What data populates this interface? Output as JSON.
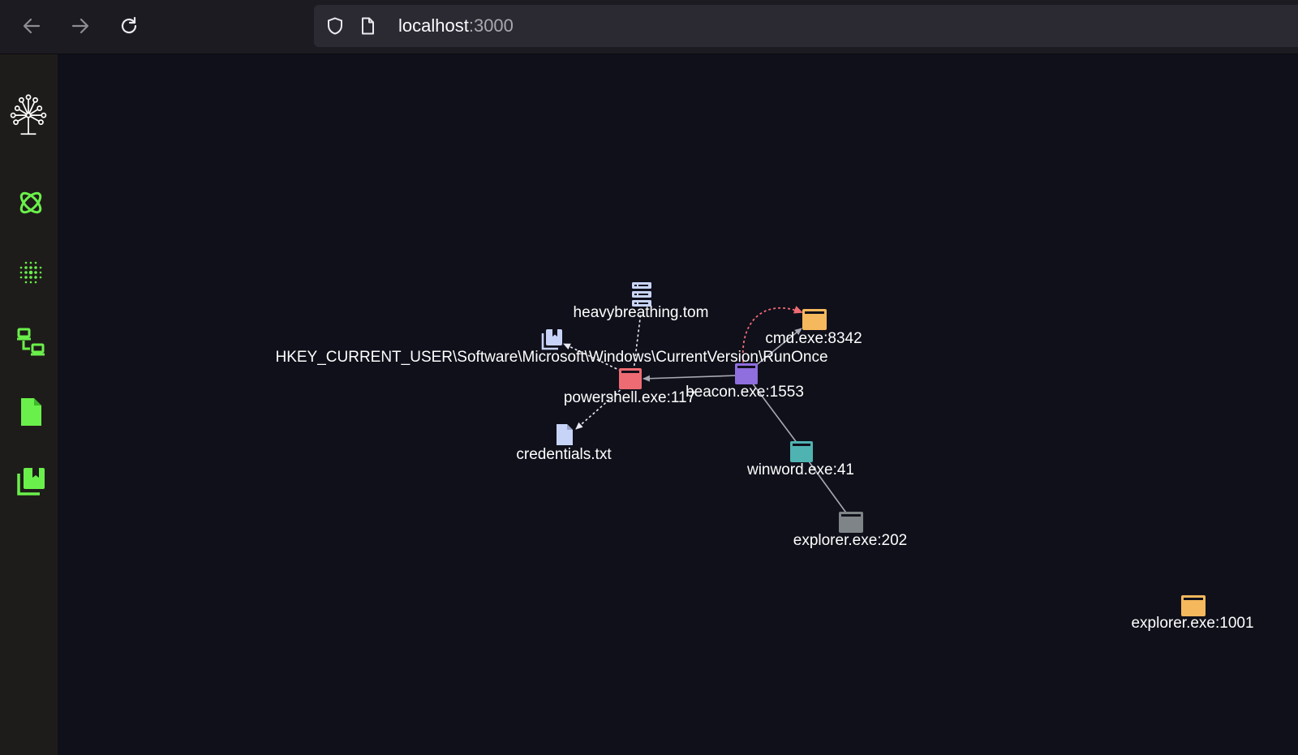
{
  "browser": {
    "url_host": "localhost",
    "url_port": ":3000",
    "back_icon": "arrow-left-icon",
    "forward_icon": "arrow-right-icon",
    "reload_icon": "reload-icon",
    "shield_icon": "shield-icon",
    "page_icon": "page-icon"
  },
  "sidebar": {
    "items": [
      {
        "icon": "tree-logo-icon",
        "color": "#ffffff"
      },
      {
        "icon": "atom-icon",
        "color": "#6af04a"
      },
      {
        "icon": "dots-grid-icon",
        "color": "#6af04a"
      },
      {
        "icon": "network-hosts-icon",
        "color": "#6af04a"
      },
      {
        "icon": "file-icon",
        "color": "#6af04a"
      },
      {
        "icon": "registry-bookmark-icon",
        "color": "#6af04a"
      }
    ]
  },
  "graph": {
    "nodes": [
      {
        "id": "heavybreathing",
        "label": "heavybreathing.tom",
        "type": "server",
        "color": "#c8d4f7"
      },
      {
        "id": "registry",
        "label": "HKEY_CURRENT_USER\\Software\\Microsoft\\Windows\\CurrentVersion\\RunOnce",
        "type": "registry",
        "color": "#c8d4f7"
      },
      {
        "id": "powershell",
        "label": "powershell.exe:117",
        "type": "process",
        "color": "#ef6b73"
      },
      {
        "id": "credentials",
        "label": "credentials.txt",
        "type": "file",
        "color": "#c8d4f7"
      },
      {
        "id": "beacon",
        "label": "beacon.exe:1553",
        "type": "process",
        "color": "#8f6ede"
      },
      {
        "id": "cmd",
        "label": "cmd.exe:8342",
        "type": "process",
        "color": "#f5b85c"
      },
      {
        "id": "winword",
        "label": "winword.exe:41",
        "type": "process",
        "color": "#4fb3b1"
      },
      {
        "id": "explorer202",
        "label": "explorer.exe:202",
        "type": "process",
        "color": "#7e8487"
      },
      {
        "id": "explorer1001",
        "label": "explorer.exe:1001",
        "type": "process",
        "color": "#f5b85c"
      }
    ],
    "edge_colors": {
      "solid": "#a9a9b3",
      "dashed": "#e9e9f3",
      "highlight": "#ef6b73"
    }
  }
}
